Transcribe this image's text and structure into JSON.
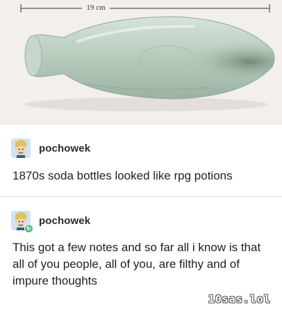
{
  "photo": {
    "measure_label": "19 cm",
    "subject": "glass-bottle-image"
  },
  "posts": [
    {
      "username": "pochowek",
      "text": "1870s soda bottles looked like rpg potions",
      "reblog": false
    },
    {
      "username": "pochowek",
      "text": "This got a few notes and so far all i know is that all of you people, all of you, are filthy and of impure thoughts",
      "reblog": true
    }
  ],
  "watermark": "10sas.lol",
  "colors": {
    "background": "#ffffff",
    "photo_bg": "#f3efec",
    "bottle_glass": "#b9cdbf",
    "reblog_badge": "#56bc8a"
  }
}
